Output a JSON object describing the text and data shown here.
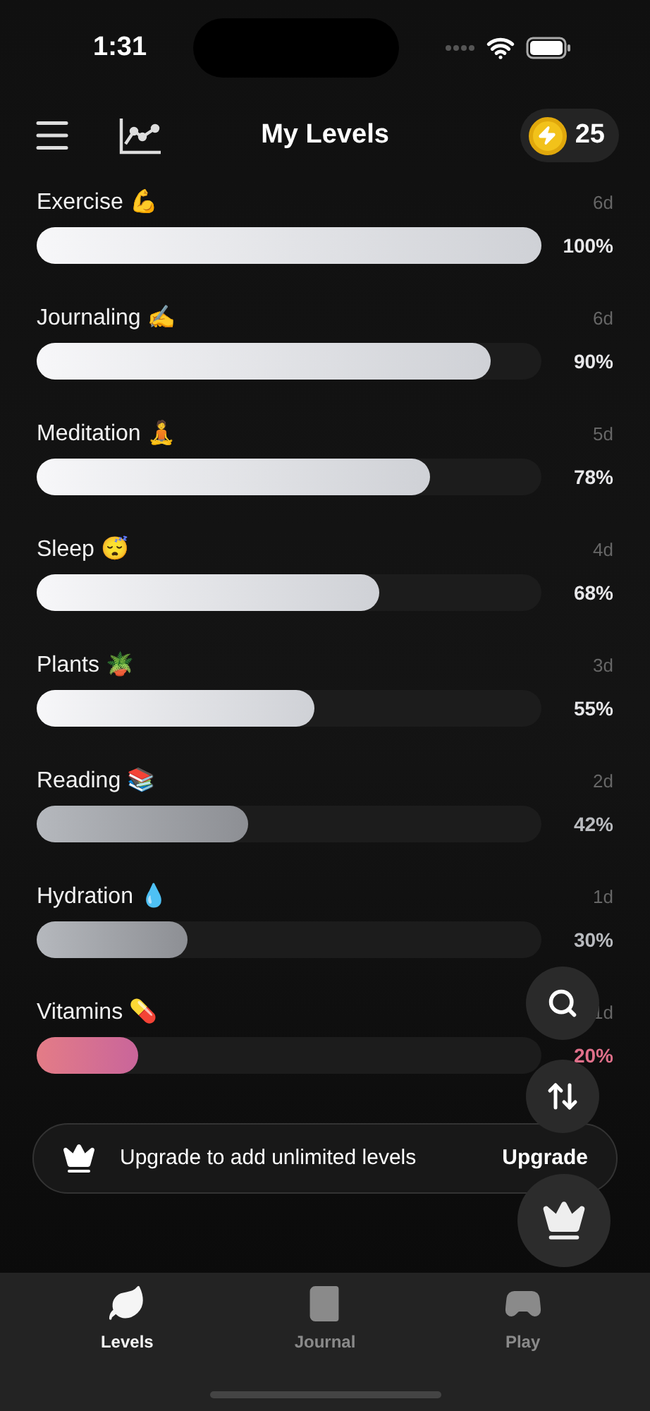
{
  "status_bar": {
    "time": "1:31"
  },
  "header": {
    "title": "My Levels",
    "coins": "25"
  },
  "levels": [
    {
      "name": "Exercise 💪",
      "days": "6d",
      "level": 1.0,
      "percent": "100%",
      "kind": "bright"
    },
    {
      "name": "Journaling ✍️",
      "days": "6d",
      "level": 0.9,
      "percent": "90%",
      "kind": "bright"
    },
    {
      "name": "Meditation 🧘",
      "days": "5d",
      "level": 0.78,
      "percent": "78%",
      "kind": "bright"
    },
    {
      "name": "Sleep 😴",
      "days": "4d",
      "level": 0.68,
      "percent": "68%",
      "kind": "bright"
    },
    {
      "name": "Plants 🪴",
      "days": "3d",
      "level": 0.55,
      "percent": "55%",
      "kind": "bright"
    },
    {
      "name": "Reading 📚",
      "days": "2d",
      "level": 0.42,
      "percent": "42%",
      "kind": "dim"
    },
    {
      "name": "Hydration 💧",
      "days": "1d",
      "level": 0.3,
      "percent": "30%",
      "kind": "dim"
    },
    {
      "name": "Vitamins 💊",
      "days": "1d",
      "level": 0.2,
      "percent": "20%",
      "kind": "alert"
    }
  ],
  "upgrade_banner": {
    "text": "Upgrade to add unlimited levels",
    "action": "Upgrade"
  },
  "tabs": [
    {
      "label": "Levels",
      "selected": true
    },
    {
      "label": "Journal",
      "selected": false
    },
    {
      "label": "Play",
      "selected": false
    }
  ]
}
